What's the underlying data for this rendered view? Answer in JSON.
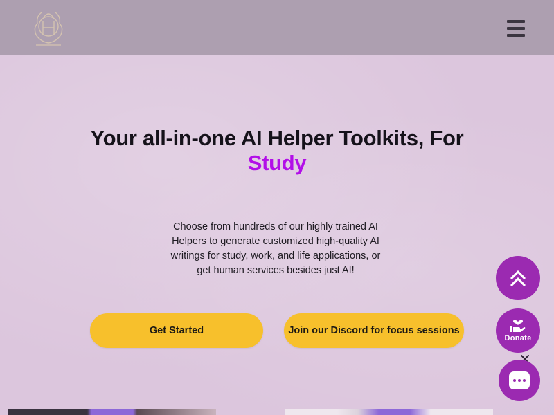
{
  "header": {
    "logo_icon": "brand-logo",
    "menu_icon": "hamburger-menu-icon"
  },
  "hero": {
    "title": "Your all-in-one AI Helper Toolkits, For",
    "title_accent": "Study",
    "description": "Choose from hundreds of our highly trained AI Helpers to generate customized high-quality AI writings for study, work, and life applications, or get human services besides just AI!",
    "primary_button": "Get Started",
    "secondary_button": "Join our Discord for focus sessions"
  },
  "floating": {
    "scroll_top_icon": "double-chevron-up-icon",
    "donate_label": "Donate",
    "donate_icon": "heart-hand-icon",
    "close_icon": "close-icon",
    "chat_icon": "chat-bubble-icon"
  },
  "colors": {
    "header_bg": "#ad9fb0",
    "page_bg": "#dcc6dd",
    "accent": "#b20fe8",
    "button_yellow": "#f7c02c",
    "fab_purple": "#9b2ab1"
  }
}
